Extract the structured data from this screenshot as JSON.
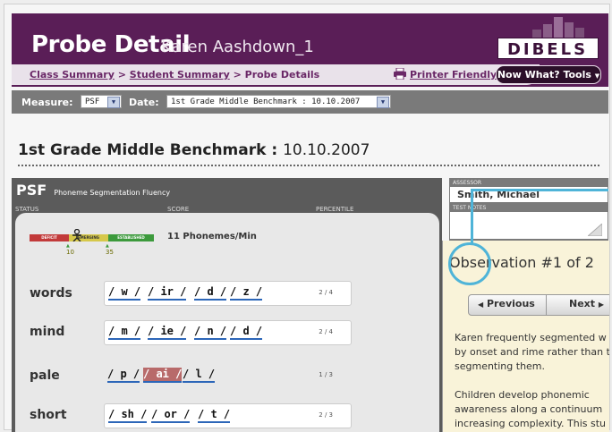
{
  "header": {
    "title": "Probe Detail",
    "student_name": "Karen Aashdown_1",
    "breadcrumbs": [
      "Class Summary",
      "Student Summary",
      "Probe Details"
    ],
    "printer_label": "Printer Friendly",
    "tools_label": "Now What? Tools",
    "logo": "DIBELS"
  },
  "filters": {
    "measure_label": "Measure:",
    "measure_value": "PSF",
    "date_label": "Date:",
    "date_value": "1st Grade Middle Benchmark : 10.10.2007"
  },
  "benchmark": {
    "name": "1st Grade Middle Benchmark :",
    "date": "10.10.2007"
  },
  "psf": {
    "abbr": "PSF",
    "full_name": "Phoneme Segmentation Fluency",
    "columns": [
      "STATUS",
      "SCORE",
      "PERCENTILE"
    ],
    "meter_labels": [
      "DEFICIT",
      "EMERGING",
      "ESTABLISHED"
    ],
    "meter_ticks": [
      "10",
      "35"
    ],
    "score_text": "11 Phonemes/Min",
    "rows": [
      {
        "word": "words",
        "segments": [
          "/ w /",
          "/ ir /",
          "/ d /",
          "/ z /"
        ],
        "fraction": "2 / 4"
      },
      {
        "word": "mind",
        "segments": [
          "/ m /",
          "/ ie /",
          "/ n /",
          "/ d /"
        ],
        "fraction": "2 / 4"
      },
      {
        "word": "pale",
        "segments": [
          "/ p /",
          "/ ai /",
          "/ l /"
        ],
        "fraction": "1 / 3"
      },
      {
        "word": "short",
        "segments": [
          "/ sh /",
          "/ or /",
          "/ t /"
        ],
        "fraction": "2 / 3"
      }
    ]
  },
  "assessor": {
    "label": "ASSESSOR",
    "name": "Smith, Michael",
    "test_notes_label": "TEST NOTES"
  },
  "observation": {
    "title": "Observation #1 of 2",
    "prev_label": "Previous",
    "next_label": "Next",
    "paragraph1": [
      "Karen frequently segmented w",
      "by onset and rime rather than t",
      "segmenting them."
    ],
    "paragraph2": [
      "Children develop phonemic",
      "awareness along a continuum",
      "increasing complexity. This stu"
    ]
  },
  "colors": {
    "header_purple": "#5a1e57",
    "accent_callout": "#4fb4d8",
    "segment_underline": "#2c66b8",
    "error_segment": "#b86a6a",
    "observation_bg": "#f9f3d9"
  }
}
